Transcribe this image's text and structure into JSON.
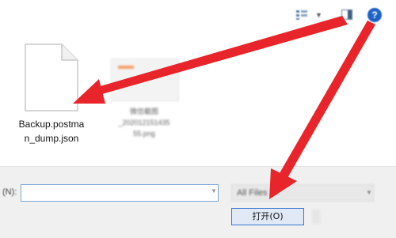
{
  "toolbar": {
    "icons": [
      "view-options-icon",
      "chevron-down-icon",
      "preview-pane-icon",
      "help-icon"
    ],
    "help_glyph": "?"
  },
  "files": [
    {
      "name_line1": "Backup.postma",
      "name_line2": "n_dump.json",
      "icon": "document-icon",
      "selected": true
    },
    {
      "name_line1": "微信截图",
      "name_line2": "_202012151435",
      "name_line3": "55.png",
      "icon": "image-thumbnail-icon"
    }
  ],
  "file_name_field": {
    "label": "(N):",
    "value": ""
  },
  "file_type": {
    "selected": "All Files"
  },
  "buttons": {
    "open": "打开(O)"
  },
  "colors": {
    "arrow": "#e8252a",
    "accent": "#3a76d0",
    "help": "#1e63c8"
  }
}
